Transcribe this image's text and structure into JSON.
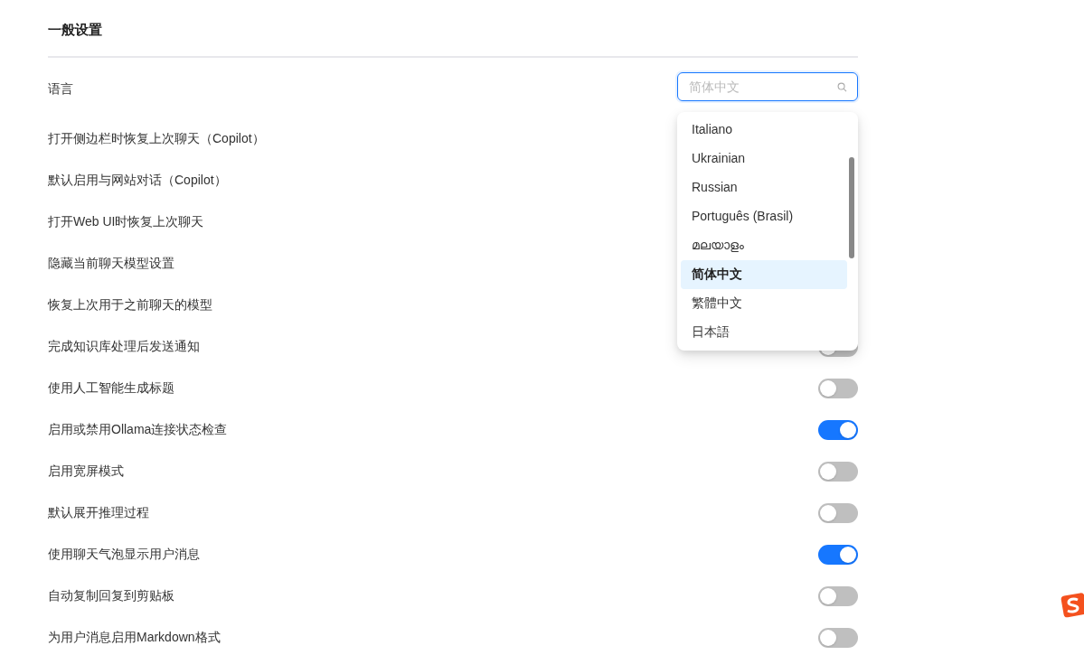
{
  "section_title": "一般设置",
  "language": {
    "label": "语言",
    "search": {
      "placeholder": "简体中文"
    },
    "options": [
      {
        "label": "Italiano",
        "selected": false
      },
      {
        "label": "Ukrainian",
        "selected": false
      },
      {
        "label": "Russian",
        "selected": false
      },
      {
        "label": "Português (Brasil)",
        "selected": false
      },
      {
        "label": "മലയാളം",
        "selected": false
      },
      {
        "label": "简体中文",
        "selected": true
      },
      {
        "label": "繁體中文",
        "selected": false
      },
      {
        "label": "日本語",
        "selected": false
      }
    ]
  },
  "settings": [
    {
      "label": "打开侧边栏时恢复上次聊天（Copilot）"
    },
    {
      "label": "默认启用与网站对话（Copilot）"
    },
    {
      "label": "打开Web UI时恢复上次聊天"
    },
    {
      "label": "隐藏当前聊天模型设置"
    },
    {
      "label": "恢复上次用于之前聊天的模型"
    },
    {
      "label": "完成知识库处理后发送通知",
      "on": false
    },
    {
      "label": "使用人工智能生成标题",
      "on": false
    },
    {
      "label": "启用或禁用Ollama连接状态检查",
      "on": true
    },
    {
      "label": "启用宽屏模式",
      "on": false
    },
    {
      "label": "默认展开推理过程",
      "on": false
    },
    {
      "label": "使用聊天气泡显示用户消息",
      "on": true
    },
    {
      "label": "自动复制回复到剪贴板",
      "on": false
    },
    {
      "label": "为用户消息启用Markdown格式",
      "on": false
    }
  ]
}
